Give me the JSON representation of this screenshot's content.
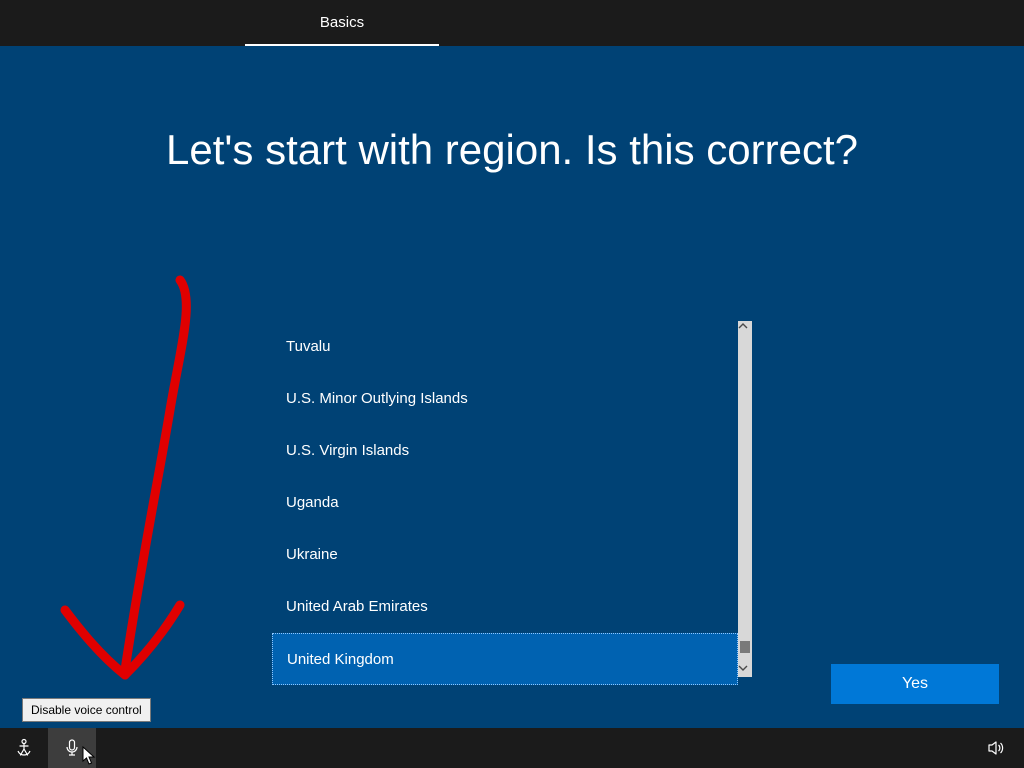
{
  "tab": {
    "label": "Basics"
  },
  "heading": "Let's start with region. Is this correct?",
  "regions": [
    "Tuvalu",
    "U.S. Minor Outlying Islands",
    "U.S. Virgin Islands",
    "Uganda",
    "Ukraine",
    "United Arab Emirates",
    "United Kingdom"
  ],
  "selected_index": 6,
  "confirm_button": "Yes",
  "tooltip": "Disable voice control",
  "icons": {
    "accessibility": "accessibility-icon",
    "microphone": "microphone-icon",
    "speaker": "speaker-icon"
  }
}
